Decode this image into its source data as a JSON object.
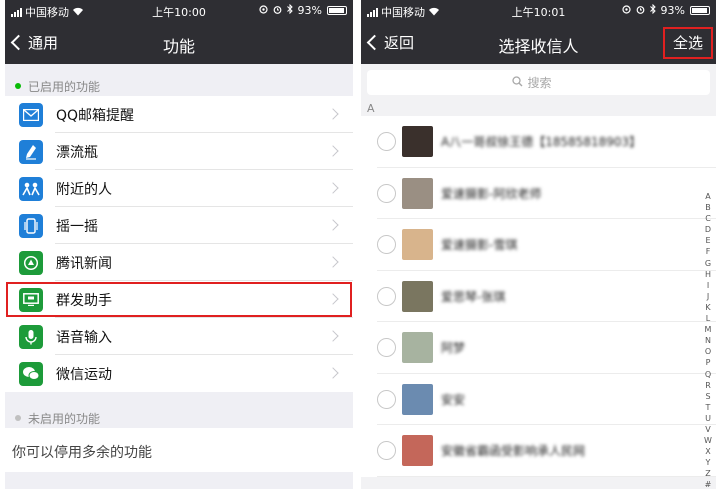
{
  "left": {
    "status": {
      "carrier": "中国移动",
      "time": "上午10:00",
      "battery": "93%"
    },
    "nav": {
      "back_label": "通用",
      "title": "功能"
    },
    "enabled_header": "已启用的功能",
    "plugins": [
      {
        "label": "QQ邮箱提醒",
        "icon": "mail-icon",
        "color": "#1f7fd8"
      },
      {
        "label": "漂流瓶",
        "icon": "bottle-icon",
        "color": "#1f7fd8"
      },
      {
        "label": "附近的人",
        "icon": "people-nearby-icon",
        "color": "#1f7fd8"
      },
      {
        "label": "摇一摇",
        "icon": "shake-phone-icon",
        "color": "#1f7fd8"
      },
      {
        "label": "腾讯新闻",
        "icon": "news-icon",
        "color": "#1d9b3a"
      },
      {
        "label": "群发助手",
        "icon": "broadcast-icon",
        "color": "#1d9b3a"
      },
      {
        "label": "语音输入",
        "icon": "microphone-icon",
        "color": "#1d9b3a"
      },
      {
        "label": "微信运动",
        "icon": "wechat-icon",
        "color": "#1d9b3a"
      }
    ],
    "disabled_header": "未启用的功能",
    "hint": "你可以停用多余的功能"
  },
  "right": {
    "status": {
      "carrier": "中国移动",
      "time": "上午10:01",
      "battery": "93%"
    },
    "nav": {
      "back_label": "返回",
      "title": "选择收信人",
      "select_all_label": "全选"
    },
    "search": {
      "placeholder": "搜索"
    },
    "section_letter": "A",
    "contacts": [
      {
        "name": "A八一哥叔徐王德【18585818903】",
        "avatar_color": "#3a302c"
      },
      {
        "name": "爱速摄影-阿欣老师",
        "avatar_color": "#9a8f83"
      },
      {
        "name": "爱速摄影-雪琪",
        "avatar_color": "#d8b48c"
      },
      {
        "name": "爱思琴-张琪",
        "avatar_color": "#7a7660"
      },
      {
        "name": "阿梦",
        "avatar_color": "#a7b3a0"
      },
      {
        "name": "安安",
        "avatar_color": "#6b8bb0"
      },
      {
        "name": "安徽省霸函受影响承人民网",
        "avatar_color": "#c4675a"
      }
    ],
    "index_letters": [
      "A",
      "B",
      "C",
      "D",
      "E",
      "F",
      "G",
      "H",
      "I",
      "J",
      "K",
      "L",
      "M",
      "N",
      "O",
      "P",
      "Q",
      "R",
      "S",
      "T",
      "U",
      "V",
      "W",
      "X",
      "Y",
      "Z",
      "#"
    ]
  },
  "colors": {
    "highlight": "#e02020",
    "nav_background": "#2e2e33",
    "enabled_dot": "#09bb07"
  }
}
